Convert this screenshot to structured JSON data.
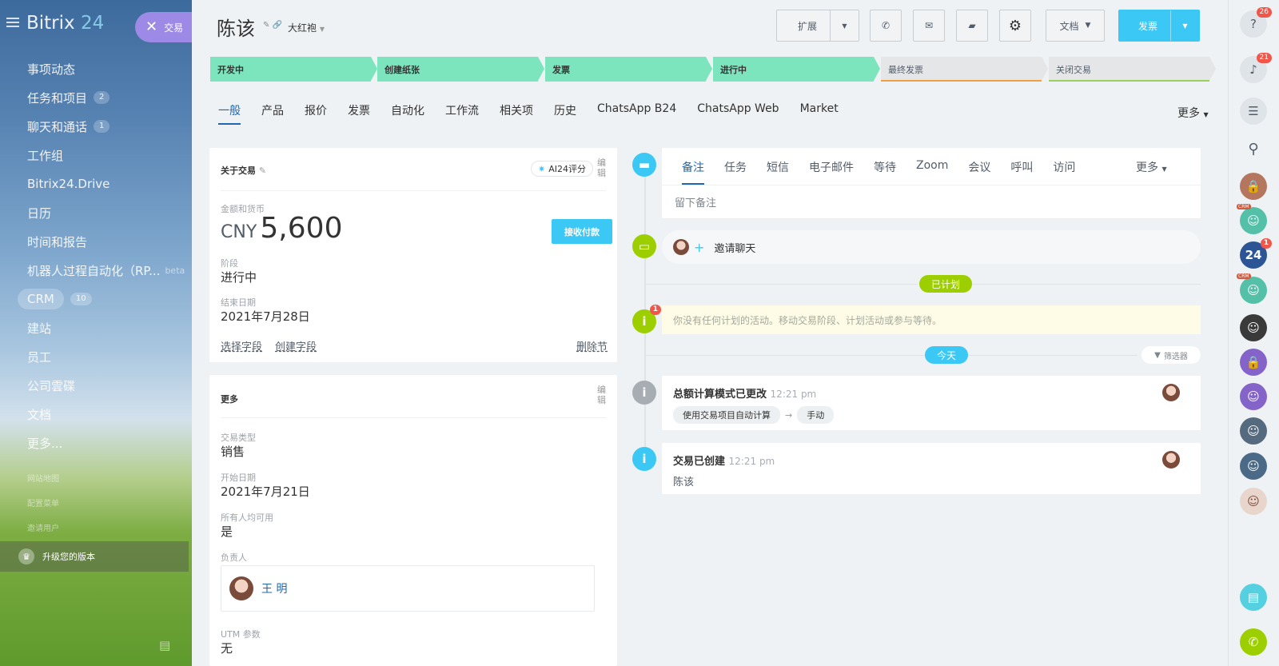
{
  "sidebar": {
    "logo_prefix": "Bitrix",
    "logo_num": "24",
    "deal_pill": "交易",
    "items": [
      {
        "label": "事项动态",
        "count": ""
      },
      {
        "label": "任务和项目",
        "count": "2"
      },
      {
        "label": "聊天和通话",
        "count": "1"
      },
      {
        "label": "工作组",
        "count": ""
      },
      {
        "label": "Bitrix24.Drive",
        "count": ""
      },
      {
        "label": "日历",
        "count": ""
      },
      {
        "label": "时间和报告",
        "count": ""
      },
      {
        "label": "机器人过程自动化（RP...",
        "count": "",
        "beta": "beta"
      },
      {
        "label": "CRM",
        "count": "10"
      },
      {
        "label": "建站",
        "count": ""
      },
      {
        "label": "员工",
        "count": ""
      },
      {
        "label": "公司雲碟",
        "count": ""
      },
      {
        "label": "文档",
        "count": ""
      },
      {
        "label": "更多...",
        "count": ""
      }
    ],
    "small": [
      "网站地图",
      "配置菜单",
      "邀请用户"
    ],
    "upgrade": "升级您的版本"
  },
  "header": {
    "title": "陈该",
    "category": "大红袍",
    "buttons": {
      "expand": "扩展",
      "docs": "文档",
      "invoice": "发票"
    }
  },
  "stages": [
    {
      "label": "开发中",
      "state": "done",
      "underline": "#7de5bd"
    },
    {
      "label": "创建纸张",
      "state": "done",
      "underline": "#7de5bd"
    },
    {
      "label": "发票",
      "state": "done",
      "underline": "#7de5bd"
    },
    {
      "label": "进行中",
      "state": "done",
      "underline": "#7de5bd"
    },
    {
      "label": "最终发票",
      "state": "todo",
      "underline": "#f0a040"
    },
    {
      "label": "关闭交易",
      "state": "todo",
      "underline": "#9bd05f"
    }
  ],
  "tabs": [
    "一般",
    "产品",
    "报价",
    "发票",
    "自动化",
    "工作流",
    "相关项",
    "历史",
    "ChatsApp B24",
    "ChatsApp Web",
    "Market"
  ],
  "tabs_more": "更多",
  "about": {
    "title": "关于交易",
    "ai": "AI24评分",
    "edit": "编辑",
    "amount_label": "金额和货币",
    "currency": "CNY",
    "amount": "5,600",
    "pay_btn": "接收付款",
    "stage_label": "阶段",
    "stage_value": "进行中",
    "end_label": "结束日期",
    "end_value": "2021年7月28日",
    "select_field": "选择字段",
    "create_field": "创建字段",
    "delete_section": "删除节"
  },
  "more": {
    "title": "更多",
    "edit": "编辑",
    "type_label": "交易类型",
    "type_value": "销售",
    "start_label": "开始日期",
    "start_value": "2021年7月21日",
    "avail_label": "所有人均可用",
    "avail_value": "是",
    "resp_label": "负责人",
    "resp_value": "王 明",
    "utm_label": "UTM 参数",
    "utm_value": "无"
  },
  "timeline": {
    "tabs": [
      "备注",
      "任务",
      "短信",
      "电子邮件",
      "等待",
      "Zoom",
      "会议",
      "呼叫",
      "访问"
    ],
    "tabs_more": "更多",
    "note_placeholder": "留下备注",
    "invite": "邀请聊天",
    "planned": "已计划",
    "empty": "你没有任何计划的活动。移动交易阶段、计划活动或参与等待。",
    "today": "今天",
    "filter": "筛选器",
    "event1": {
      "title": "总额计算模式已更改",
      "time": "12:21 pm",
      "from": "使用交易项目自动计算",
      "to": "手动"
    },
    "event2": {
      "title": "交易已创建",
      "time": "12:21 pm",
      "body": "陈该"
    },
    "info_badge": "1"
  },
  "rightbar": {
    "help_badge": "26",
    "bell_badge": "21",
    "b24_badge": "1",
    "crm_tag": "CRM"
  }
}
